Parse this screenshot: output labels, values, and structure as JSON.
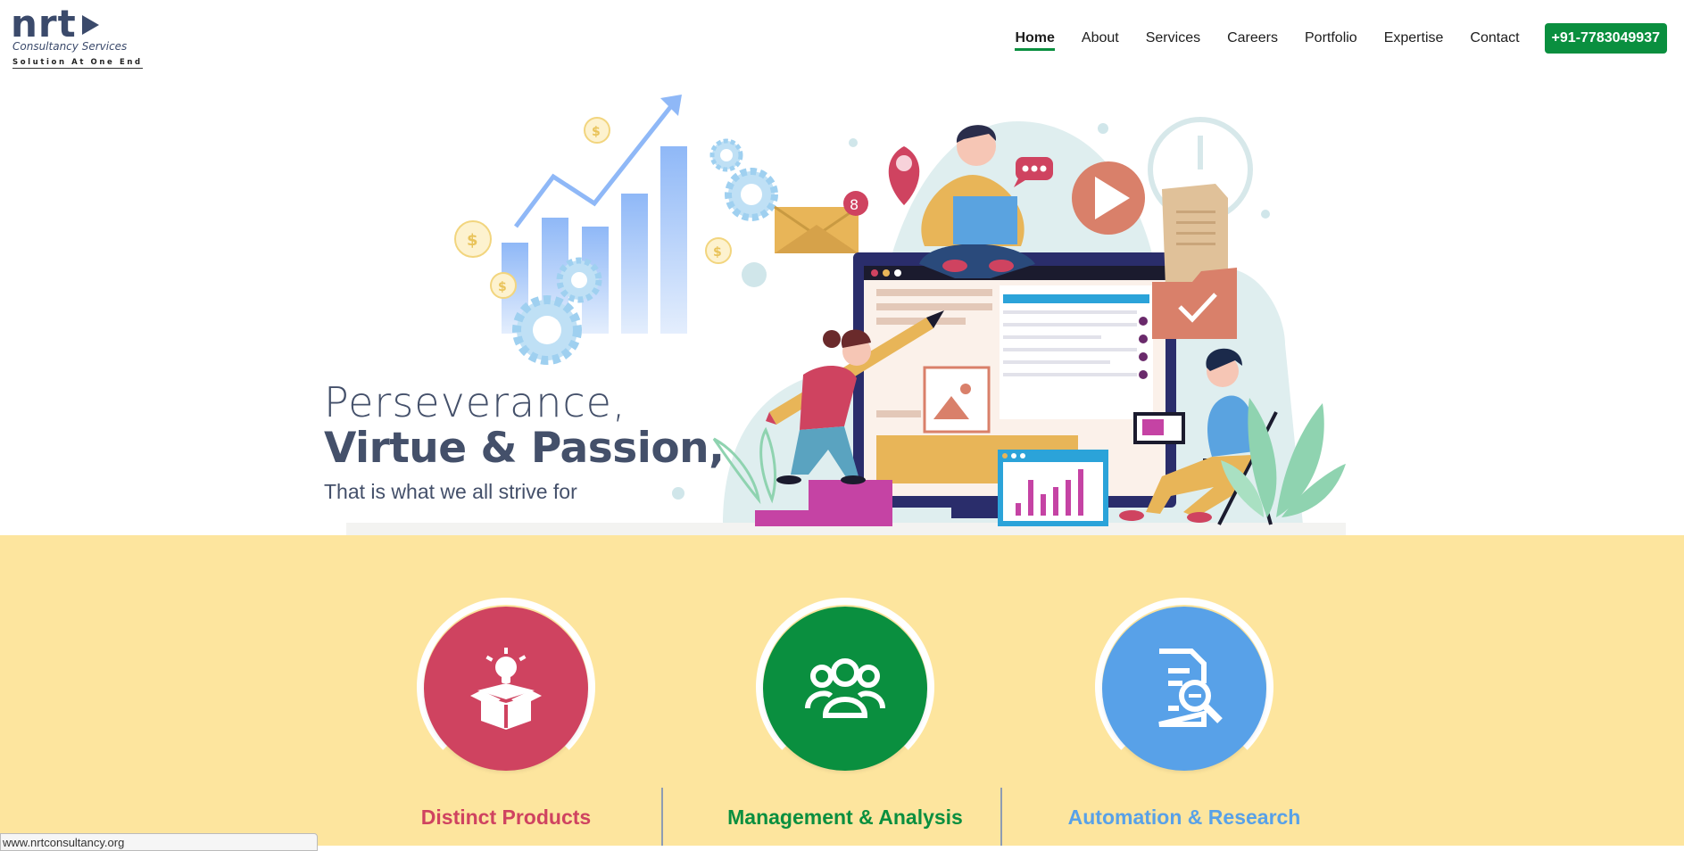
{
  "brand": {
    "name": "nrt",
    "subtitle": "Consultancy  Services",
    "tagline": "Solution At One End"
  },
  "nav": {
    "items": [
      {
        "label": "Home",
        "active": true
      },
      {
        "label": "About"
      },
      {
        "label": "Services"
      },
      {
        "label": "Careers"
      },
      {
        "label": "Portfolio"
      },
      {
        "label": "Expertise"
      },
      {
        "label": "Contact"
      }
    ],
    "phone": "+91-7783049937"
  },
  "hero": {
    "line1": "Perseverance,",
    "line2": "Virtue & Passion,",
    "line3": "That is what we all strive for",
    "email_badge_count": "8"
  },
  "features": [
    {
      "title": "Distinct Products",
      "color": "#cf4360",
      "icon": "open-box-idea-icon"
    },
    {
      "title": "Management & Analysis",
      "color": "#0a8f3f",
      "icon": "group-users-icon"
    },
    {
      "title": "Automation & Research",
      "color": "#58a1e8",
      "icon": "document-search-icon"
    }
  ],
  "status_bar": {
    "url": "www.nrtconsultancy.org"
  },
  "colors": {
    "accent_green": "#0a8f3f",
    "text_dark": "#44506a",
    "features_bg": "#fde59e"
  }
}
